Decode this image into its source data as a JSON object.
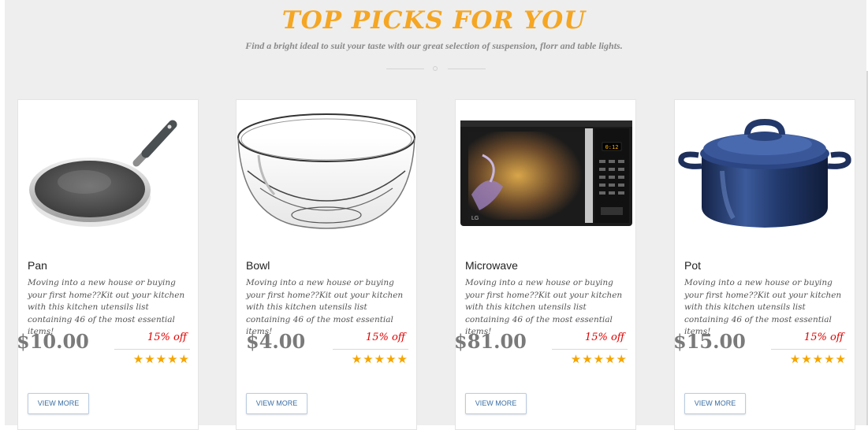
{
  "header": {
    "title": "TOP PICKS FOR YOU",
    "subtitle": "Find a bright ideal to suit your taste with our great selection of suspension, florr and table lights."
  },
  "products": [
    {
      "name": "Pan",
      "description": "Moving into a new house or buying your first home??Kit out your kitchen with this kitchen utensils list containing 46 of the most essential items!",
      "price": "$10.00",
      "discount": "15% off",
      "rating": "★★★★★",
      "button": "VIEW MORE",
      "image_icon": "frying-pan-image"
    },
    {
      "name": "Bowl",
      "description": "Moving into a new house or buying your first home??Kit out your kitchen with this kitchen utensils list containing 46 of the most essential items!",
      "price": "$4.00",
      "discount": "15% off",
      "rating": "★★★★★",
      "button": "VIEW MORE",
      "image_icon": "glass-bowl-image"
    },
    {
      "name": "Microwave",
      "description": "Moving into a new house or buying your first home??Kit out your kitchen with this kitchen utensils list containing 46 of the most essential items!",
      "price": "$81.00",
      "discount": "15% off",
      "rating": "★★★★★",
      "button": "VIEW MORE",
      "image_icon": "microwave-image",
      "brand": "LG",
      "display": "0:12"
    },
    {
      "name": "Pot",
      "description": "Moving into a new house or buying your first home??Kit out your kitchen with this kitchen utensils list containing 46 of the most essential items!",
      "price": "$15.00",
      "discount": "15% off",
      "rating": "★★★★★",
      "button": "VIEW MORE",
      "image_icon": "pot-image"
    }
  ],
  "colors": {
    "accent": "#f5a623",
    "discount": "#e00000",
    "star": "#f5a500",
    "button_text": "#3a6ea5"
  }
}
